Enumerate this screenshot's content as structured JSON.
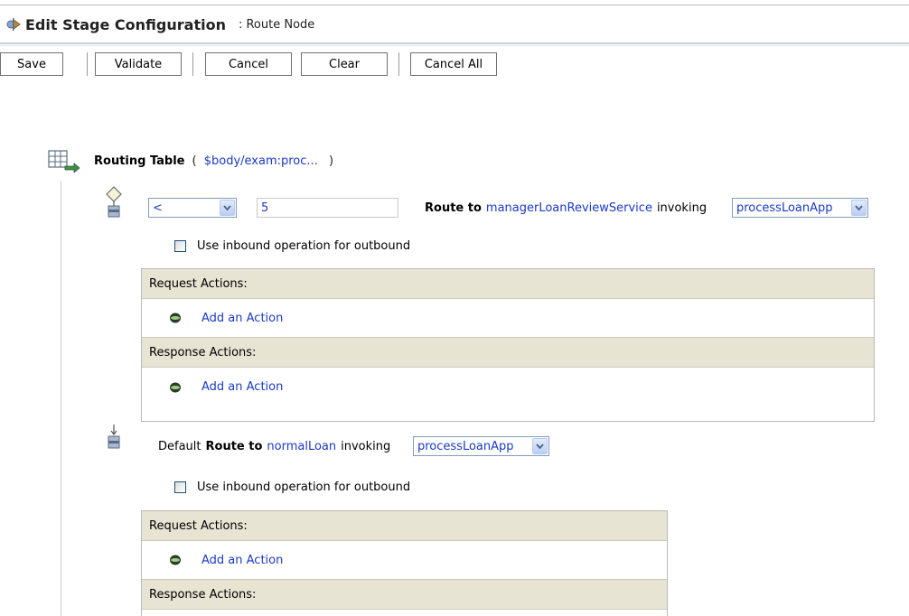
{
  "header": {
    "title_prefix": "Edit Stage Configuration",
    "subtitle": ": Route Node"
  },
  "toolbar": {
    "save_label": "Save",
    "validate_label": "Validate",
    "cancel_label": "Cancel",
    "clear_label": "Clear",
    "cancel_all_label": "Cancel All"
  },
  "routing_table": {
    "label": "Routing Table",
    "paren_open": "(",
    "expression": "$body/exam:proc...",
    "paren_close": ")"
  },
  "case": {
    "operator": "<",
    "value": "5",
    "route_to_label": "Route to",
    "service": "managerLoanReviewService",
    "invoking_label": "invoking",
    "operation": "processLoanApp",
    "checkbox_label": "Use inbound operation for outbound",
    "request_actions_label": "Request Actions:",
    "request_add_action": "Add an Action",
    "response_actions_label": "Response Actions:",
    "response_add_action": "Add an Action"
  },
  "default_case": {
    "default_label": "Default",
    "route_to_label": "Route to",
    "service": "normalLoan",
    "invoking_label": "invoking",
    "operation": "processLoanApp",
    "checkbox_label": "Use inbound operation for outbound",
    "request_actions_label": "Request Actions:",
    "request_add_action": "Add an Action",
    "response_actions_label": "Response Actions:"
  },
  "colors": {
    "link": "#1a39c9",
    "action_header_bg": "#e8e4d3",
    "select_border": "#7f9db9"
  },
  "icons": {
    "header": "stage-icon",
    "routing_table": "routing-table-icon",
    "case": "route-case-icon",
    "default_case": "default-route-icon",
    "add_action": "add-action-icon",
    "dropdown": "chevron-down-icon"
  }
}
